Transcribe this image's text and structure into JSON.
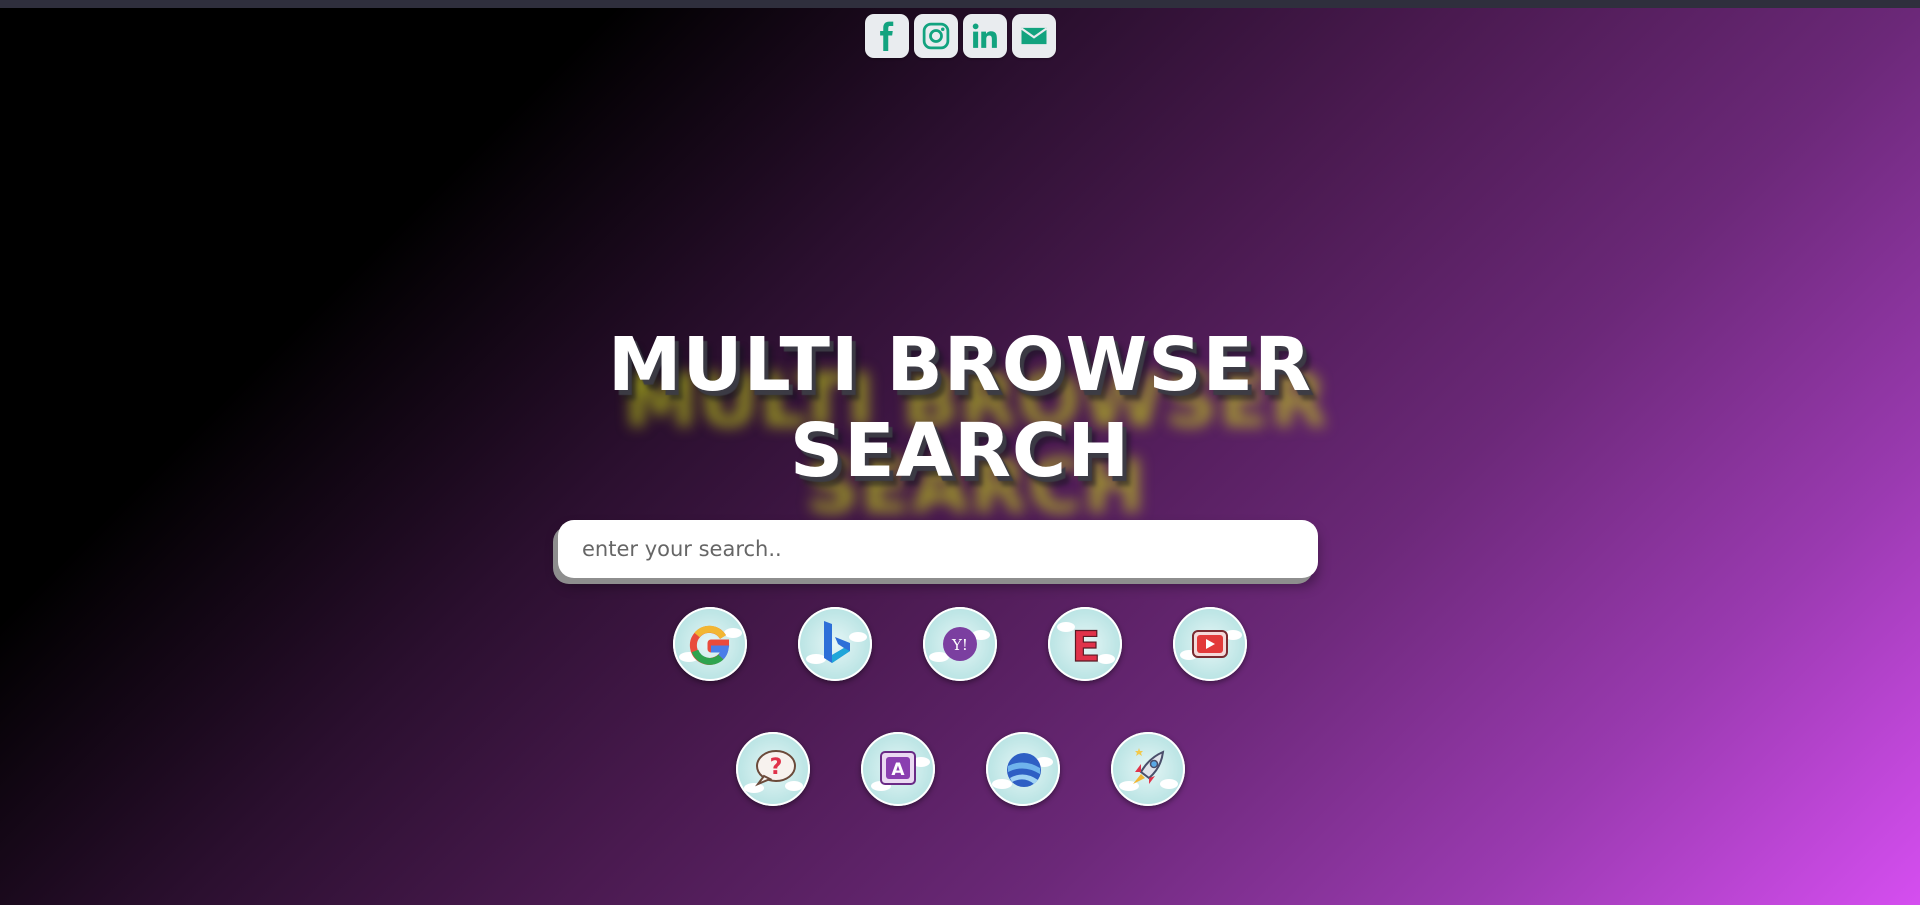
{
  "social": [
    {
      "name": "facebook",
      "icon": "facebook-icon"
    },
    {
      "name": "instagram",
      "icon": "instagram-icon"
    },
    {
      "name": "linkedin",
      "icon": "linkedin-icon"
    },
    {
      "name": "email",
      "icon": "envelope-icon"
    }
  ],
  "header": {
    "title_line1": "MULTI BROWSER",
    "title_line2": "SEARCH"
  },
  "search": {
    "placeholder": "enter your search..",
    "value": ""
  },
  "engines_row1": [
    {
      "name": "google",
      "icon": "google-icon",
      "letter": "G"
    },
    {
      "name": "bing",
      "icon": "bing-icon",
      "letter": "b"
    },
    {
      "name": "yahoo",
      "icon": "yahoo-icon",
      "letter": "Y!"
    },
    {
      "name": "ecosia",
      "icon": "ecosia-icon",
      "letter": "E"
    },
    {
      "name": "youtube",
      "icon": "youtube-icon",
      "letter": ""
    }
  ],
  "engines_row2": [
    {
      "name": "ask",
      "icon": "question-bubble-icon",
      "letter": "?"
    },
    {
      "name": "aol",
      "icon": "letter-a-icon",
      "letter": "A"
    },
    {
      "name": "google-earth",
      "icon": "globe-icon",
      "letter": ""
    },
    {
      "name": "rocket",
      "icon": "rocket-icon",
      "letter": ""
    }
  ],
  "colors": {
    "social_icon": "#12a37f",
    "social_bg": "#e9ecef",
    "title_glow": "#dcf014"
  }
}
